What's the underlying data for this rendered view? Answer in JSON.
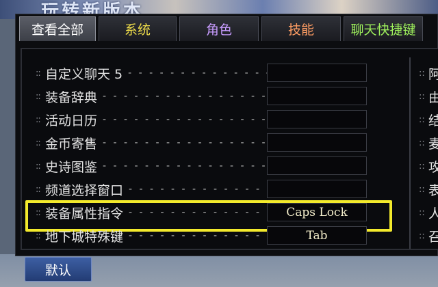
{
  "background": {
    "title_text": "玩转新版本"
  },
  "tabs": [
    {
      "label": "查看全部",
      "active": true
    },
    {
      "label": "系统"
    },
    {
      "label": "角色"
    },
    {
      "label": "技能"
    },
    {
      "label": "聊天快捷键"
    }
  ],
  "rows": [
    {
      "prefix": "::",
      "label": "自定义聊天 5",
      "key": ""
    },
    {
      "prefix": "::",
      "label": "装备辞典",
      "key": ""
    },
    {
      "prefix": "::",
      "label": "活动日历",
      "key": ""
    },
    {
      "prefix": "::",
      "label": "金币寄售",
      "key": ""
    },
    {
      "prefix": "::",
      "label": "史诗图鉴",
      "key": ""
    },
    {
      "prefix": "::",
      "label": "频道选择窗口",
      "key": ""
    },
    {
      "prefix": "::",
      "label": "装备属性指令",
      "key": "Caps Lock",
      "highlight": true
    },
    {
      "prefix": "::",
      "label": "地下城特殊键",
      "key": "Tab"
    }
  ],
  "right_column": [
    {
      "prefix": "::",
      "label": "阿"
    },
    {
      "prefix": "::",
      "label": "由"
    },
    {
      "prefix": "::",
      "label": "结"
    },
    {
      "prefix": "::",
      "label": "麦"
    },
    {
      "prefix": "::",
      "label": "攻"
    },
    {
      "prefix": "::",
      "label": "表"
    },
    {
      "prefix": "::",
      "label": "人"
    },
    {
      "prefix": "::",
      "label": "召"
    }
  ],
  "buttons": {
    "default_label": "默认"
  },
  "colors": {
    "highlight": "#f3ea2c",
    "tab_system": "#f0de4a",
    "tab_role": "#c89cff",
    "tab_skill": "#ff9d63",
    "tab_chat": "#9ef05c",
    "button_blue": "#2c4a8a"
  }
}
